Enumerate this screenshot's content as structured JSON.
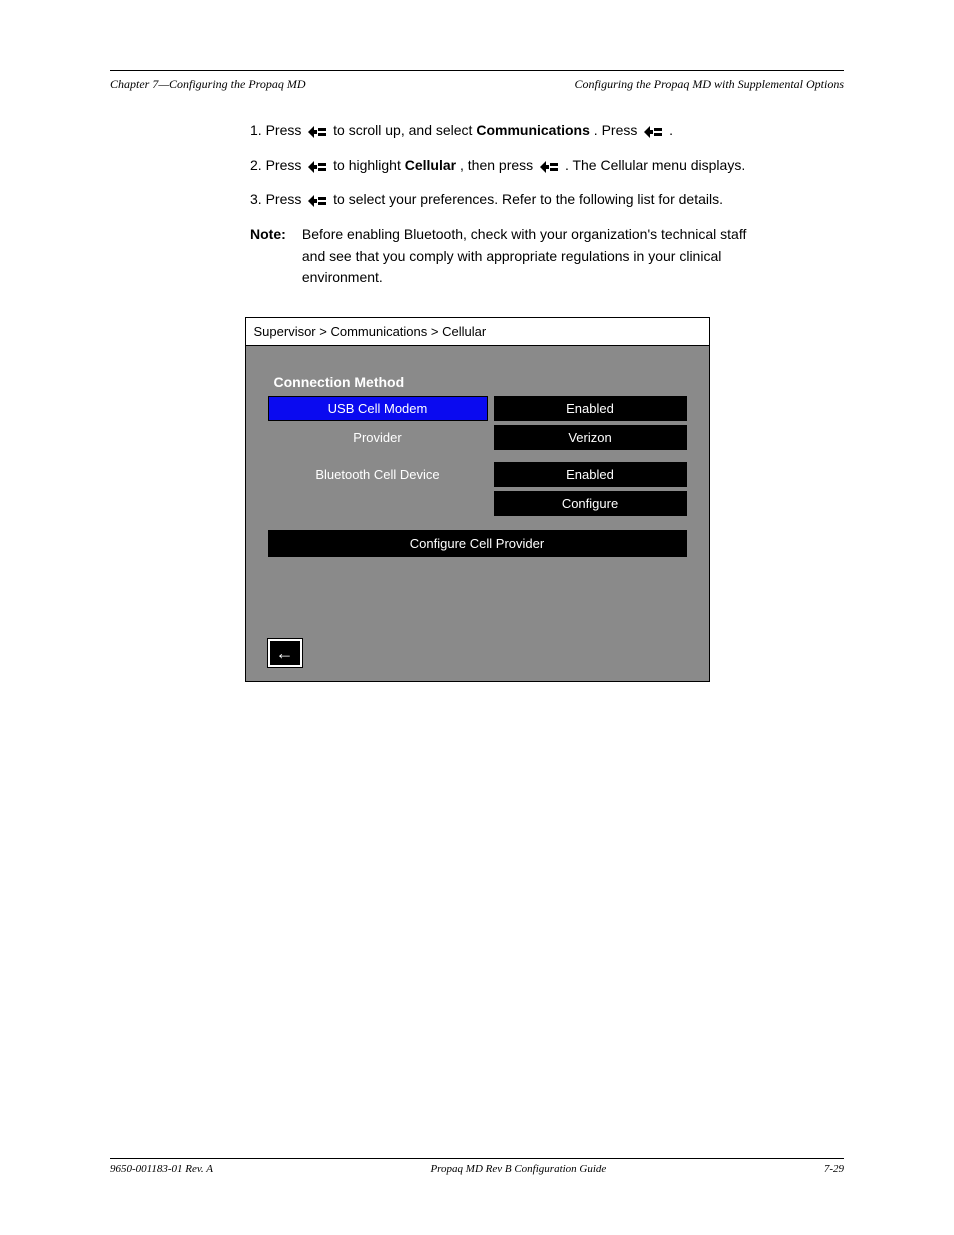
{
  "header": {
    "left": "Chapter 7—Configuring the Propaq MD",
    "right": "Configuring the Propaq MD with Supplemental Options"
  },
  "body": {
    "step1_prefix": "1. Press ",
    "step1_mid": " to scroll up, and select ",
    "step1_suffix": "Communications",
    "step1_after": ". Press ",
    "step1_end": ".",
    "step2_prefix": "2. Press ",
    "step2_mid": " to highlight ",
    "step2_cell": "Cellular",
    "step2_after": ", then press ",
    "step2_end": ". The Cellular menu displays.",
    "step3_prefix": "3. Press ",
    "step3_mid": " to select your preferences. Refer to the following list for details.",
    "note_label": "Note:",
    "note_text": "Before enabling Bluetooth, check with your organization's technical staff and see that you comply with appropriate regulations in your clinical environment."
  },
  "screenshot": {
    "breadcrumb": "Supervisor > Communications > Cellular",
    "section_title": "Connection Method",
    "rows": [
      {
        "label": "USB Cell Modem",
        "value": "Enabled",
        "selected": true
      },
      {
        "label": "Provider",
        "value": "Verizon",
        "selected": false
      },
      {
        "label": "Bluetooth Cell Device",
        "value": "Enabled",
        "selected": false
      },
      {
        "label": "",
        "value": "Configure",
        "selected": false
      }
    ],
    "full_button": "Configure Cell Provider",
    "back_arrow": "←"
  },
  "footer": {
    "left": "9650-001183-01 Rev. A",
    "center": "",
    "right": "7-29",
    "product": "Propaq MD Rev B Configuration Guide"
  }
}
